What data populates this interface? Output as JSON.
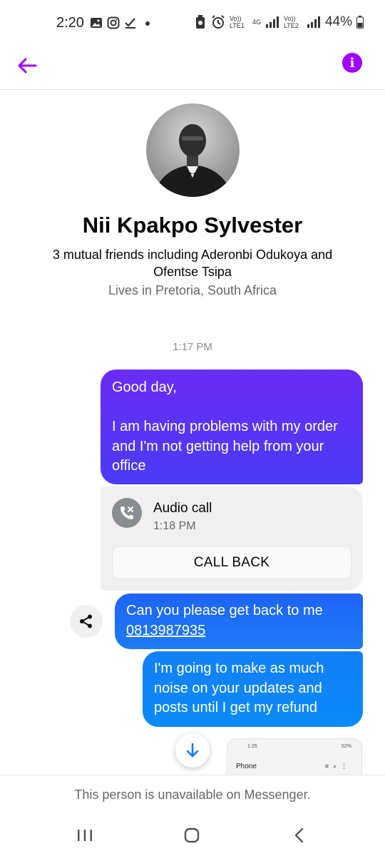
{
  "status_bar": {
    "time": "2:20",
    "left_icons": [
      "gallery-icon",
      "instagram-icon",
      "check-download-icon",
      "dot-icon"
    ],
    "right_icons": [
      "battery-saver-icon",
      "alarm-icon",
      "volte-icon",
      "signal-icon",
      "volte-icon",
      "signal-icon"
    ],
    "lte1_label": "Vo)) LTE1",
    "net_label": "4G",
    "lte2_label": "Vo)) LTE2",
    "battery": "44%"
  },
  "header": {
    "back_icon": "arrow-left-icon",
    "info_icon": "info-icon",
    "accent_color": "#a100ff"
  },
  "profile": {
    "name": "Nii Kpakpo Sylvester",
    "mutual": "3 mutual friends including Aderonbi Odukoya and Ofentse Tsipa",
    "lives": "Lives in Pretoria, South Africa"
  },
  "conversation": {
    "timestamp": "1:17 PM",
    "message_1": {
      "line_1": "Good day,",
      "line_2": "I am having problems with my order and I'm not getting help from your office"
    },
    "call": {
      "title": "Audio call",
      "time": "1:18 PM",
      "button": "CALL BACK",
      "icon": "missed-call-icon"
    },
    "message_2": {
      "text": "Can you please get back to me",
      "phone": "0813987935"
    },
    "message_3": "I'm going to make as much noise on your updates and posts until I get my refund",
    "attachment": {
      "status_time": "1:25",
      "status_battery": "52%",
      "title": "Phone"
    }
  },
  "footer": {
    "unavailable": "This person is unavailable on Messenger."
  },
  "nav": {
    "recents_icon": "recents-icon",
    "home_icon": "home-icon",
    "back_icon": "nav-back-icon"
  }
}
